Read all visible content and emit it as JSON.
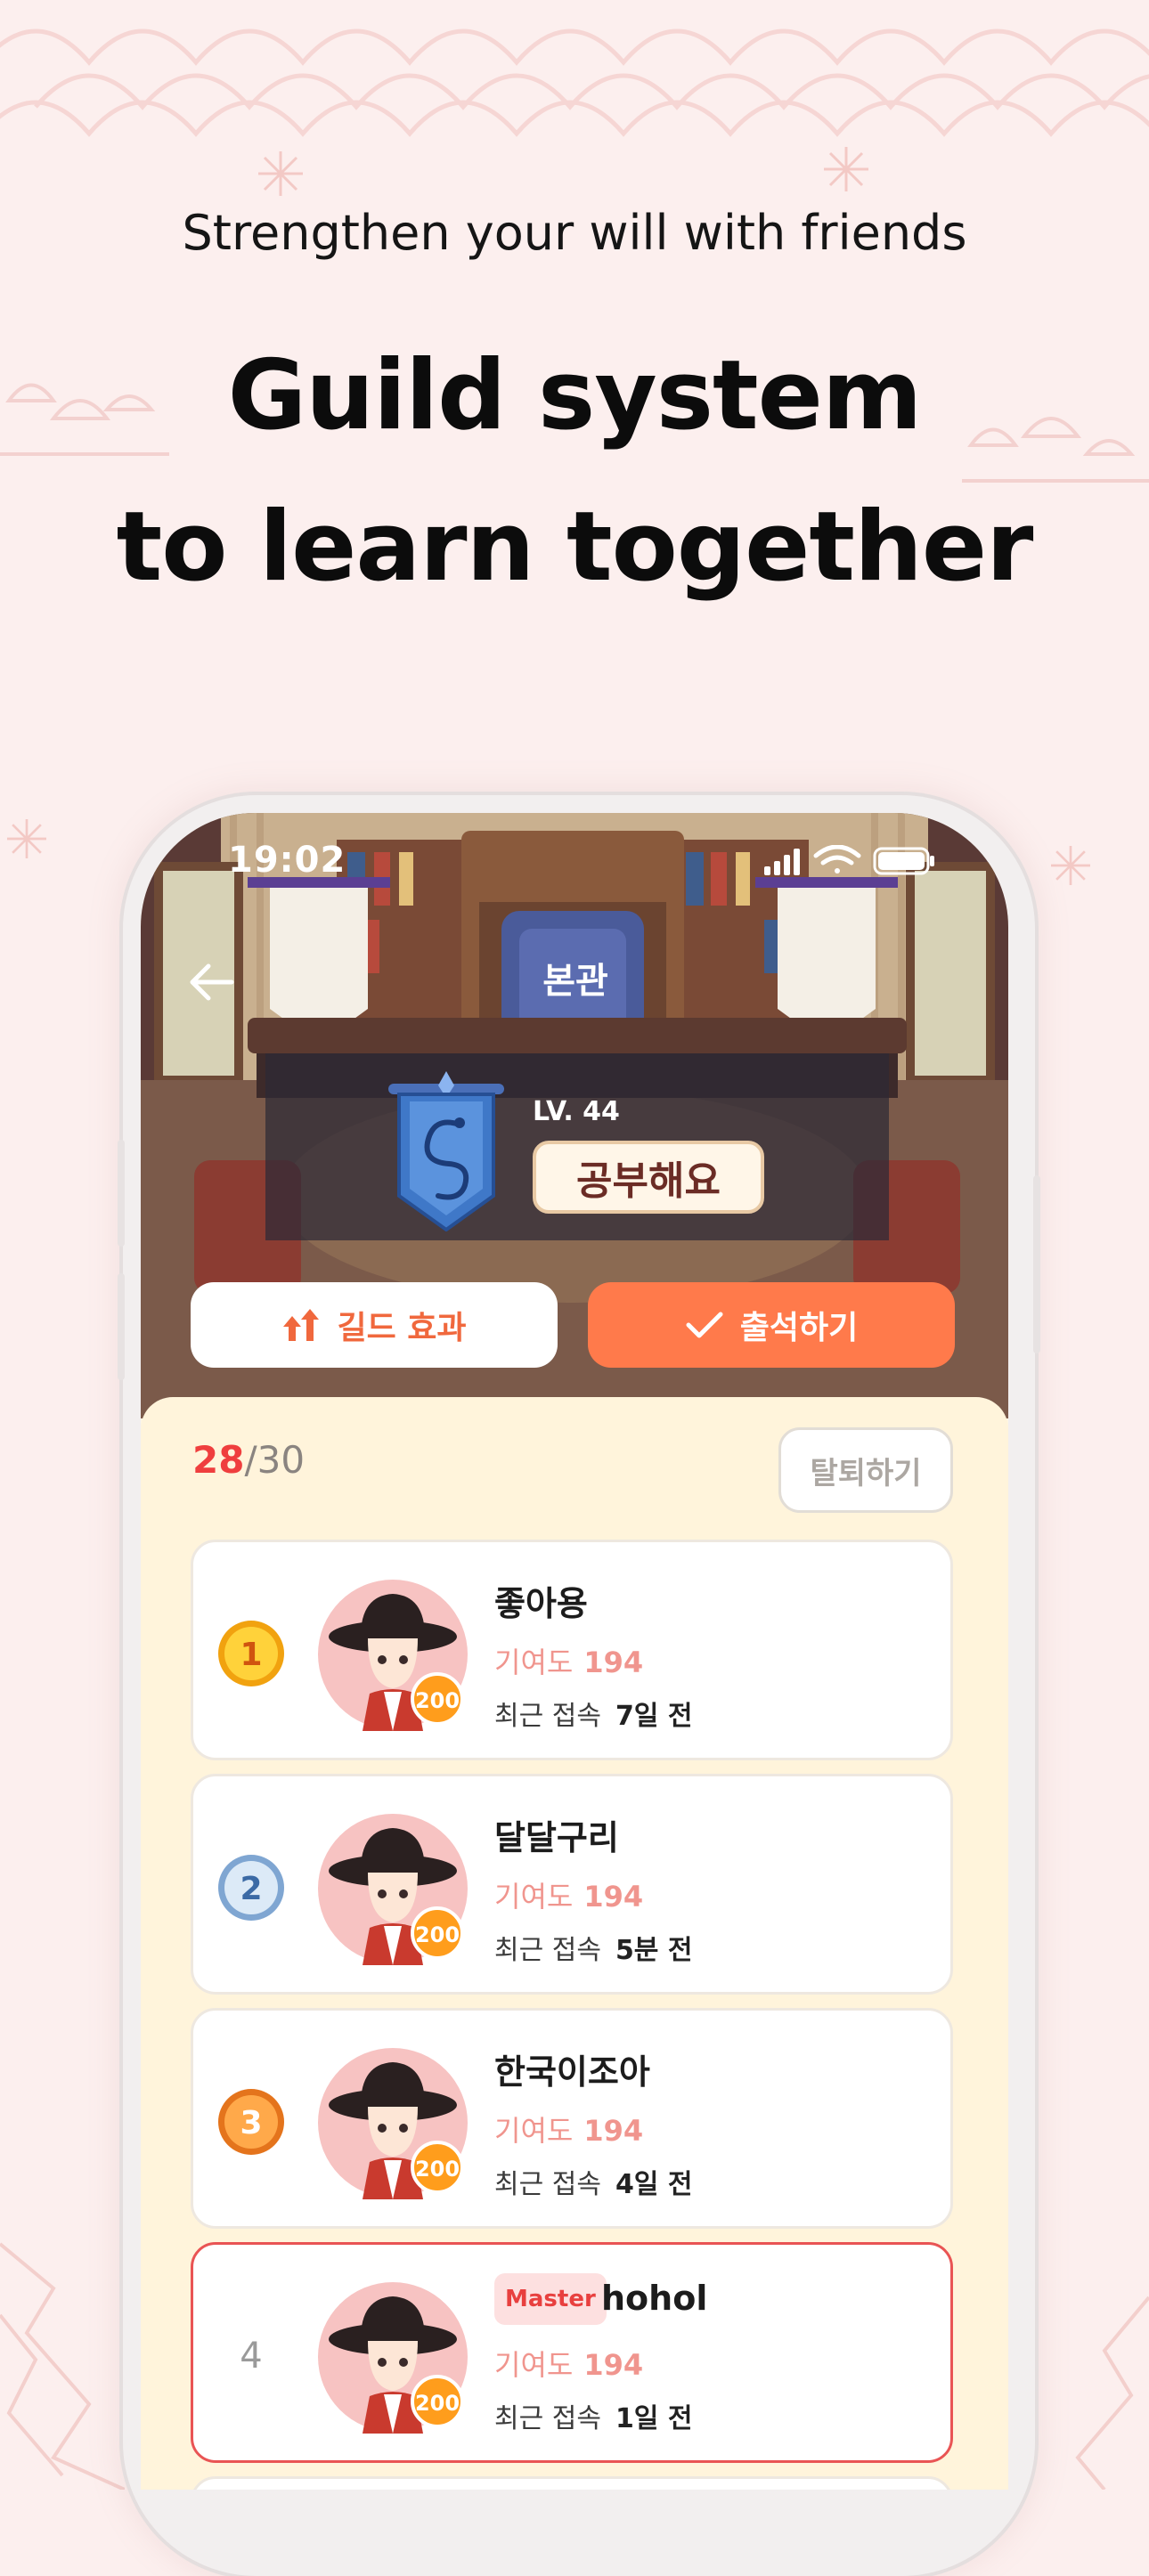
{
  "header": {
    "tagline": "Strengthen your will with friends",
    "headline_line1": "Guild system",
    "headline_line2": "to learn together"
  },
  "status_bar": {
    "time": "19:02"
  },
  "scene": {
    "hall_sign": "본관"
  },
  "guild": {
    "level": "LV. 44",
    "name": "공부해요"
  },
  "actions": {
    "effect_label": "길드 효과",
    "attend_label": "출석하기"
  },
  "members_header": {
    "current": "28",
    "total": "/30",
    "leave_label": "탈퇴하기"
  },
  "members": [
    {
      "rank": "1",
      "name": "좋아용",
      "contrib_label": "기여도",
      "contrib_value": "194",
      "badge": "200",
      "lastseen_label": "최근 접속",
      "lastseen_value": "7일 전"
    },
    {
      "rank": "2",
      "name": "달달구리",
      "contrib_label": "기여도",
      "contrib_value": "194",
      "badge": "200",
      "lastseen_label": "최근 접속",
      "lastseen_value": "5분 전"
    },
    {
      "rank": "3",
      "name": "한국이조아",
      "contrib_label": "기여도",
      "contrib_value": "194",
      "badge": "200",
      "lastseen_label": "최근 접속",
      "lastseen_value": "4일 전"
    },
    {
      "rank": "4",
      "role": "Master",
      "name": "hohol",
      "contrib_label": "기여도",
      "contrib_value": "194",
      "badge": "200",
      "lastseen_label": "최근 접속",
      "lastseen_value": "1일 전"
    }
  ],
  "colors": {
    "background": "#fcefee",
    "accent": "#ff7a4b",
    "panel": "#fff4db",
    "contribution": "#f0958e",
    "master_red": "#e95454"
  },
  "icons": [
    "back-arrow-icon",
    "signal-icon",
    "wifi-icon",
    "battery-icon",
    "level-up-arrows-icon",
    "checkmark-icon",
    "gold-medal-icon",
    "silver-medal-icon",
    "bronze-medal-icon",
    "dragon-banner-icon"
  ]
}
